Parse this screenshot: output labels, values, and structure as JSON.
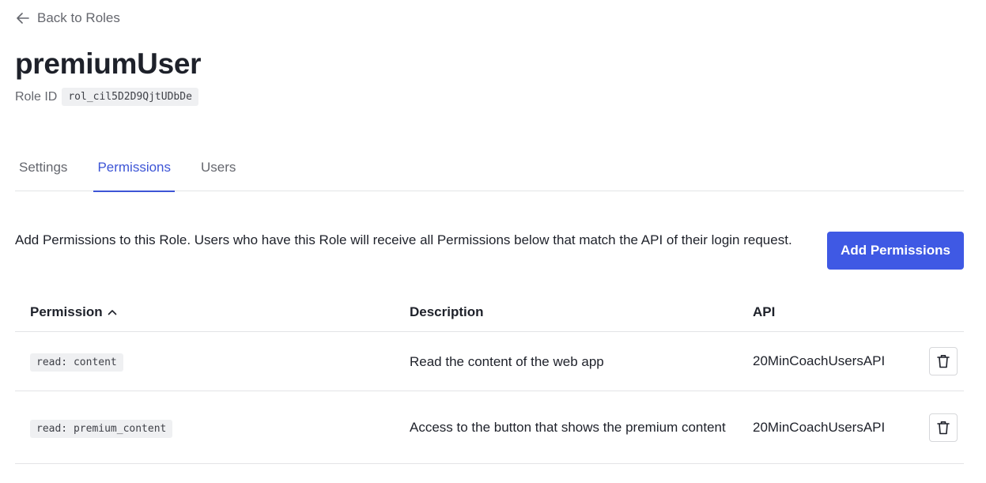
{
  "nav": {
    "back_label": "Back to Roles"
  },
  "role": {
    "name": "premiumUser",
    "id_label": "Role ID",
    "id_value": "rol_cil5D2D9QjtUDbDe"
  },
  "tabs": [
    {
      "label": "Settings",
      "active": false
    },
    {
      "label": "Permissions",
      "active": true
    },
    {
      "label": "Users",
      "active": false
    }
  ],
  "permissions_panel": {
    "intro": "Add Permissions to this Role. Users who have this Role will receive all Permissions below that match the API of their login request.",
    "add_button_label": "Add Permissions",
    "columns": {
      "permission": "Permission",
      "description": "Description",
      "api": "API"
    },
    "sort": {
      "column": "permission",
      "direction": "ascending"
    },
    "rows": [
      {
        "permission": "read: content",
        "description": "Read the content of the web app",
        "api": "20MinCoachUsersAPI"
      },
      {
        "permission": "read: premium_content",
        "description": "Access to the button that shows the premium content",
        "api": "20MinCoachUsersAPI"
      }
    ]
  },
  "icons": {
    "back": "arrow-left-icon",
    "sort": "chevron-up-icon",
    "delete": "trash-icon"
  },
  "colors": {
    "accent": "#3f59e4",
    "active_tab": "#3d55d6",
    "text": "#1e212a",
    "muted": "#65676e"
  }
}
